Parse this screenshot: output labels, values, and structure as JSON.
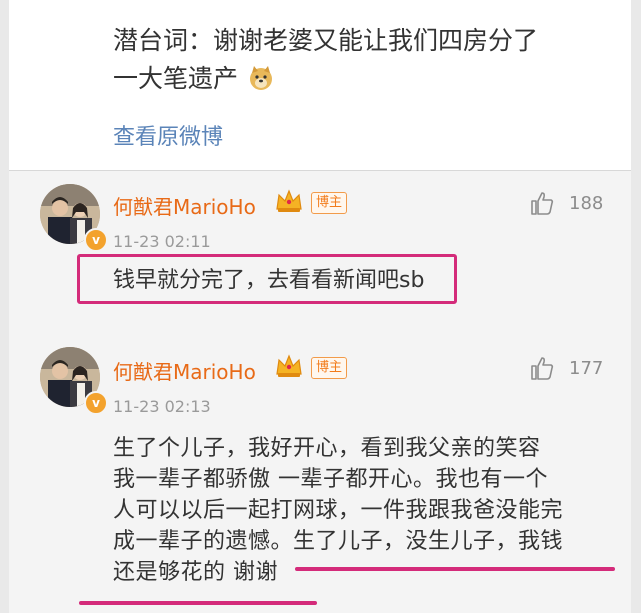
{
  "post": {
    "text_line1": "潜台词：谢谢老婆又能让我们四房分了",
    "text_line2": "一大笔遗产",
    "emoji": "doge-icon",
    "view_original": "查看原微博"
  },
  "comments": [
    {
      "author": "何猷君MarioHo",
      "badge": "博主",
      "time": "11-23 02:11",
      "likes": "188",
      "text": "钱早就分完了，去看看新闻吧sb"
    },
    {
      "author": "何猷君MarioHo",
      "badge": "博主",
      "time": "11-23 02:13",
      "likes": "177",
      "lines": [
        "生了个儿子，我好开心，看到我父亲的笑容",
        "我一辈子都骄傲 一辈子都开心。我也有一个",
        "人可以以后一起打网球，一件我跟我爸没能完",
        "成一辈子的遗憾。生了儿子，没生儿子，我钱",
        "还是够花的 谢谢"
      ]
    }
  ],
  "colors": {
    "author": "#e86a17",
    "link": "#5b84b8",
    "annotation": "#d42b7a"
  }
}
